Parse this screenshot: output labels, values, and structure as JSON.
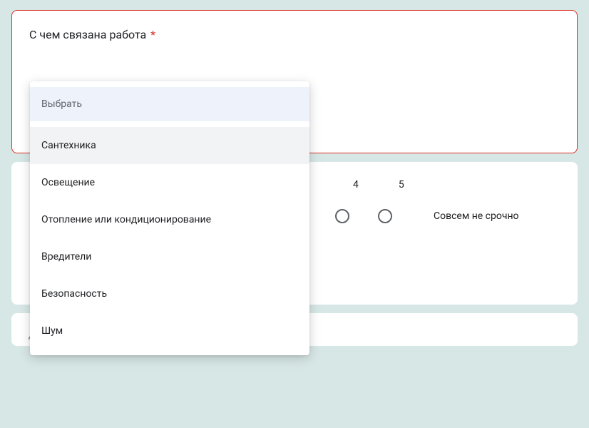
{
  "question1": {
    "label": "С чем связана работа",
    "required_marker": "*",
    "dropdown": {
      "placeholder": "Выбрать",
      "options": [
        "Сантехника",
        "Освещение",
        "Отопление или кондиционирование",
        "Вредители",
        "Безопасность",
        "Шум"
      ]
    }
  },
  "question2": {
    "scale_values": [
      "4",
      "5"
    ],
    "end_label": "Совсем не срочно"
  },
  "question3": {
    "date_label": "Дата"
  }
}
